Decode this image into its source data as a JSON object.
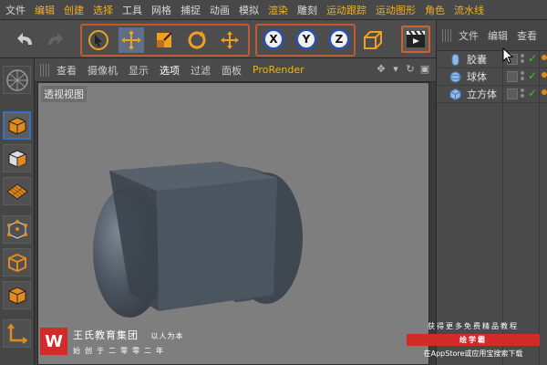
{
  "menu": {
    "items": [
      {
        "label": "文件",
        "hl": false
      },
      {
        "label": "编辑",
        "hl": true
      },
      {
        "label": "创建",
        "hl": true
      },
      {
        "label": "选择",
        "hl": true
      },
      {
        "label": "工具",
        "hl": false
      },
      {
        "label": "网格",
        "hl": false
      },
      {
        "label": "捕捉",
        "hl": false
      },
      {
        "label": "动画",
        "hl": false
      },
      {
        "label": "模拟",
        "hl": false
      },
      {
        "label": "渲染",
        "hl": true
      },
      {
        "label": "雕刻",
        "hl": false
      },
      {
        "label": "运动跟踪",
        "hl": true
      },
      {
        "label": "运动图形",
        "hl": true
      },
      {
        "label": "角色",
        "hl": true
      },
      {
        "label": "流水线",
        "hl": true
      }
    ]
  },
  "toolbar": {
    "axis_x": "X",
    "axis_y": "Y",
    "axis_z": "Z",
    "icons": [
      "undo-icon",
      "redo-icon",
      "select-arrow-icon",
      "move-icon",
      "scale-icon",
      "rotate-icon",
      "recent-tool-icon",
      "coordinate-system-icon",
      "render-view-icon"
    ]
  },
  "object_manager": {
    "tabs": [
      "文件",
      "编辑",
      "查看"
    ],
    "objects": [
      {
        "name": "胶囊",
        "icon": "capsule-icon"
      },
      {
        "name": "球体",
        "icon": "sphere-icon"
      },
      {
        "name": "立方体",
        "icon": "cube-icon"
      }
    ],
    "check_glyph": "✓"
  },
  "viewport": {
    "menu": [
      "查看",
      "摄像机",
      "显示",
      "选项",
      "过滤",
      "面板"
    ],
    "renderer": "ProRender",
    "active_menu": "选项",
    "label": "透视视图",
    "background_color": "#7e7e7e",
    "object_color": "#4b5560"
  },
  "palette": {
    "icons": [
      "view-perspective-icon",
      "model-mode-icon",
      "texture-mode-icon",
      "workplane-icon",
      "points-mode-icon",
      "edges-mode-icon",
      "polygons-mode-icon",
      "axis-mode-icon"
    ]
  },
  "watermark": {
    "logo_letter": "W",
    "company": "王氏教育集团",
    "motto": "以人为本",
    "founded": "始创于二零零二年",
    "promo_line1": "获得更多免费精品教程",
    "promo_brand": "绘学霸",
    "promo_line3": "在AppStore或应用宝搜索下载"
  },
  "colors": {
    "accent_orange": "#f0b020",
    "tool_frame": "#d06030",
    "axis_blue": "#3050a0",
    "watermark_red": "#d32a2a"
  }
}
